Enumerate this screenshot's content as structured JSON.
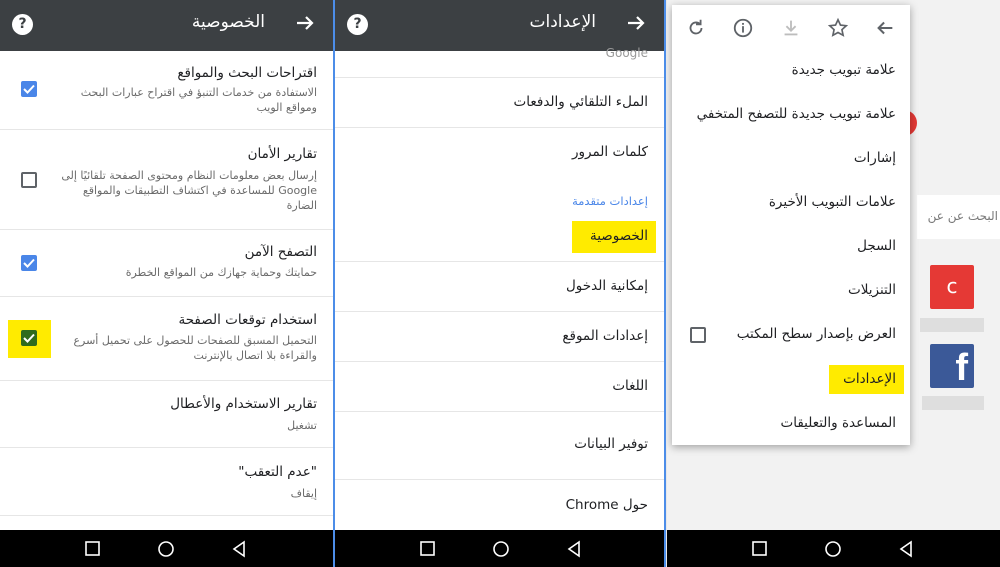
{
  "privacy_screen": {
    "title": "الخصوصية",
    "rows": [
      {
        "title": "اقتراحات البحث والمواقع",
        "subtitle": "الاستفادة من خدمات التنبؤ في اقتراح عبارات البحث ومواقع الويب",
        "checked": true
      },
      {
        "title": "تقارير الأمان",
        "subtitle": "إرسال بعض معلومات النظام ومحتوى الصفحة تلقائيًا إلى Google للمساعدة في اكتشاف التطبيقات والمواقع الضارة",
        "checked": false
      },
      {
        "title": "التصفح الآمن",
        "subtitle": "حمايتك وحماية جهازك من المواقع الخطرة",
        "checked": true
      },
      {
        "title": "استخدام توقعات الصفحة",
        "subtitle": "التحميل المسبق للصفحات للحصول على تحميل أسرع والقراءة بلا اتصال بالإنترنت",
        "checked": true,
        "highlighted": true
      },
      {
        "title": "تقارير الاستخدام والأعطال",
        "subtitle": "تشغيل"
      },
      {
        "title": "\"عدم التعقب\"",
        "subtitle": "إيقاف"
      }
    ]
  },
  "settings_screen": {
    "title": "الإعدادات",
    "partial_top": "Google",
    "items": [
      "الملء التلقائي والدفعات",
      "كلمات المرور"
    ],
    "section_label": "إعدادات متقدمة",
    "highlighted_item": "الخصوصية",
    "items_after": [
      "إمكانية الدخول",
      "إعدادات الموقع",
      "اللغات",
      "توفير البيانات",
      "حول Chrome"
    ]
  },
  "browser_menu": {
    "items": [
      "علامة تبويب جديدة",
      "علامة تبويب جديدة للتصفح المتخفي",
      "إشارات",
      "علامات التبويب الأخيرة",
      "السجل",
      "التنزيلات",
      "العرض بإصدار سطح المكتب",
      "الإعدادات",
      "المساعدة والتعليقات"
    ],
    "background_search_text": "البحث عن عن",
    "tile_letter": "c",
    "tile_colors": {
      "c_tile": "#e53935",
      "facebook_tile": "#3b5998"
    }
  },
  "colors": {
    "highlight": "#ffeb00",
    "accent": "#4a86e8",
    "appbar": "#3c4043"
  }
}
